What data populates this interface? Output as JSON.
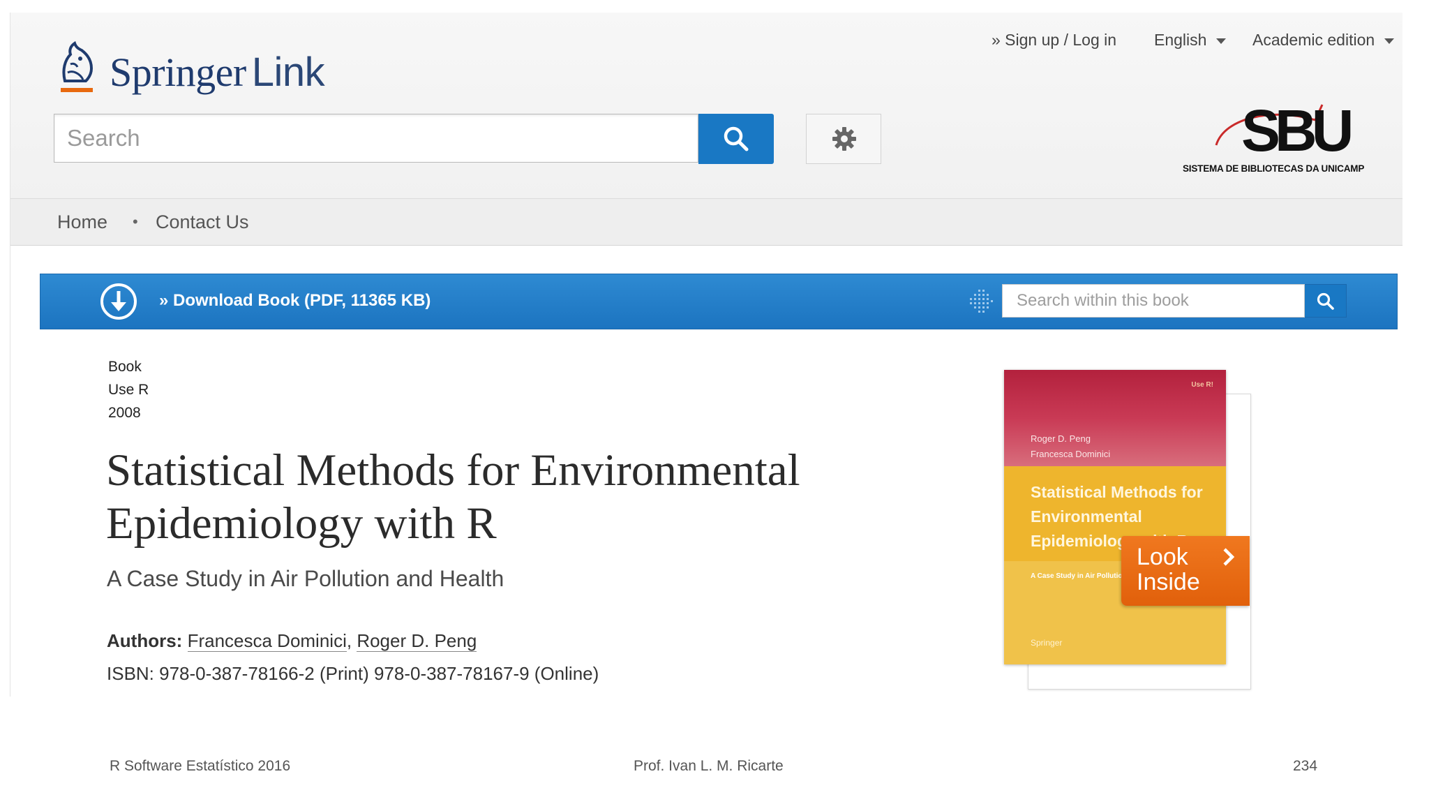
{
  "header": {
    "logo_text": "Springer",
    "logo_suffix": "Link",
    "signup_link": "» Sign up / Log in",
    "language": "English",
    "edition": "Academic edition",
    "search_placeholder": "Search",
    "institution": {
      "acronym": "SBU",
      "full_name": "SISTEMA DE BIBLIOTECAS DA UNICAMP"
    }
  },
  "nav": {
    "items": [
      {
        "label": "Home"
      },
      {
        "label": "Contact Us"
      }
    ],
    "separator": "•"
  },
  "download_bar": {
    "label": "» Download Book (PDF, 11365 KB)",
    "search_placeholder": "Search within this book"
  },
  "book": {
    "type": "Book",
    "series": "Use R",
    "year": "2008",
    "title": "Statistical Methods for Environmental Epidemiology with R",
    "subtitle": "A Case Study in Air Pollution and Health",
    "authors_label": "Authors:",
    "authors": [
      "Francesca Dominici",
      "Roger D. Peng"
    ],
    "isbn": "ISBN: 978-0-387-78166-2 (Print) 978-0-387-78167-9 (Online)"
  },
  "cover": {
    "series": "Use R!",
    "authors": [
      "Roger D. Peng",
      "Francesca Dominici"
    ],
    "title": "Statistical Methods for Environmental Epidemiology with R",
    "subtitle": "A Case Study in Air Pollution and Health",
    "publisher": "Springer",
    "look_inside": "Look Inside"
  },
  "footer": {
    "left": "R Software Estatístico 2016",
    "center": "Prof. Ivan L. M. Ricarte",
    "page": "234"
  },
  "colors": {
    "brand_blue": "#1978c4",
    "springer_navy": "#1f3b6e",
    "look_inside_orange": "#e8690f",
    "cover_red": "#b3213d",
    "cover_yellow": "#eeb52d"
  }
}
